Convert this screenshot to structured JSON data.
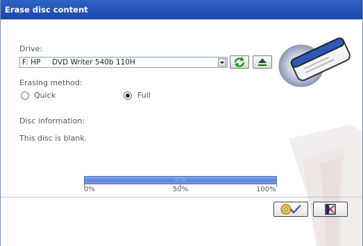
{
  "window": {
    "title": "Erase disc content"
  },
  "drive": {
    "label": "Drive:",
    "selected": "F: HP     DVD Writer 540b 110H"
  },
  "toolbar": {
    "refresh_icon": "refresh-icon",
    "eject_icon": "eject-icon"
  },
  "erasing": {
    "label": "Erasing method:",
    "options": [
      "Quick",
      "Full"
    ],
    "selected": "Full"
  },
  "disc_info": {
    "label": "Disc information:",
    "text": "This disc is blank."
  },
  "progress": {
    "value": 0,
    "text": "0%",
    "ticks": [
      "0%",
      "50%",
      "100%"
    ]
  },
  "buttons": {
    "erase_icon": "disc-check-icon",
    "exit_icon": "exit-icon"
  }
}
